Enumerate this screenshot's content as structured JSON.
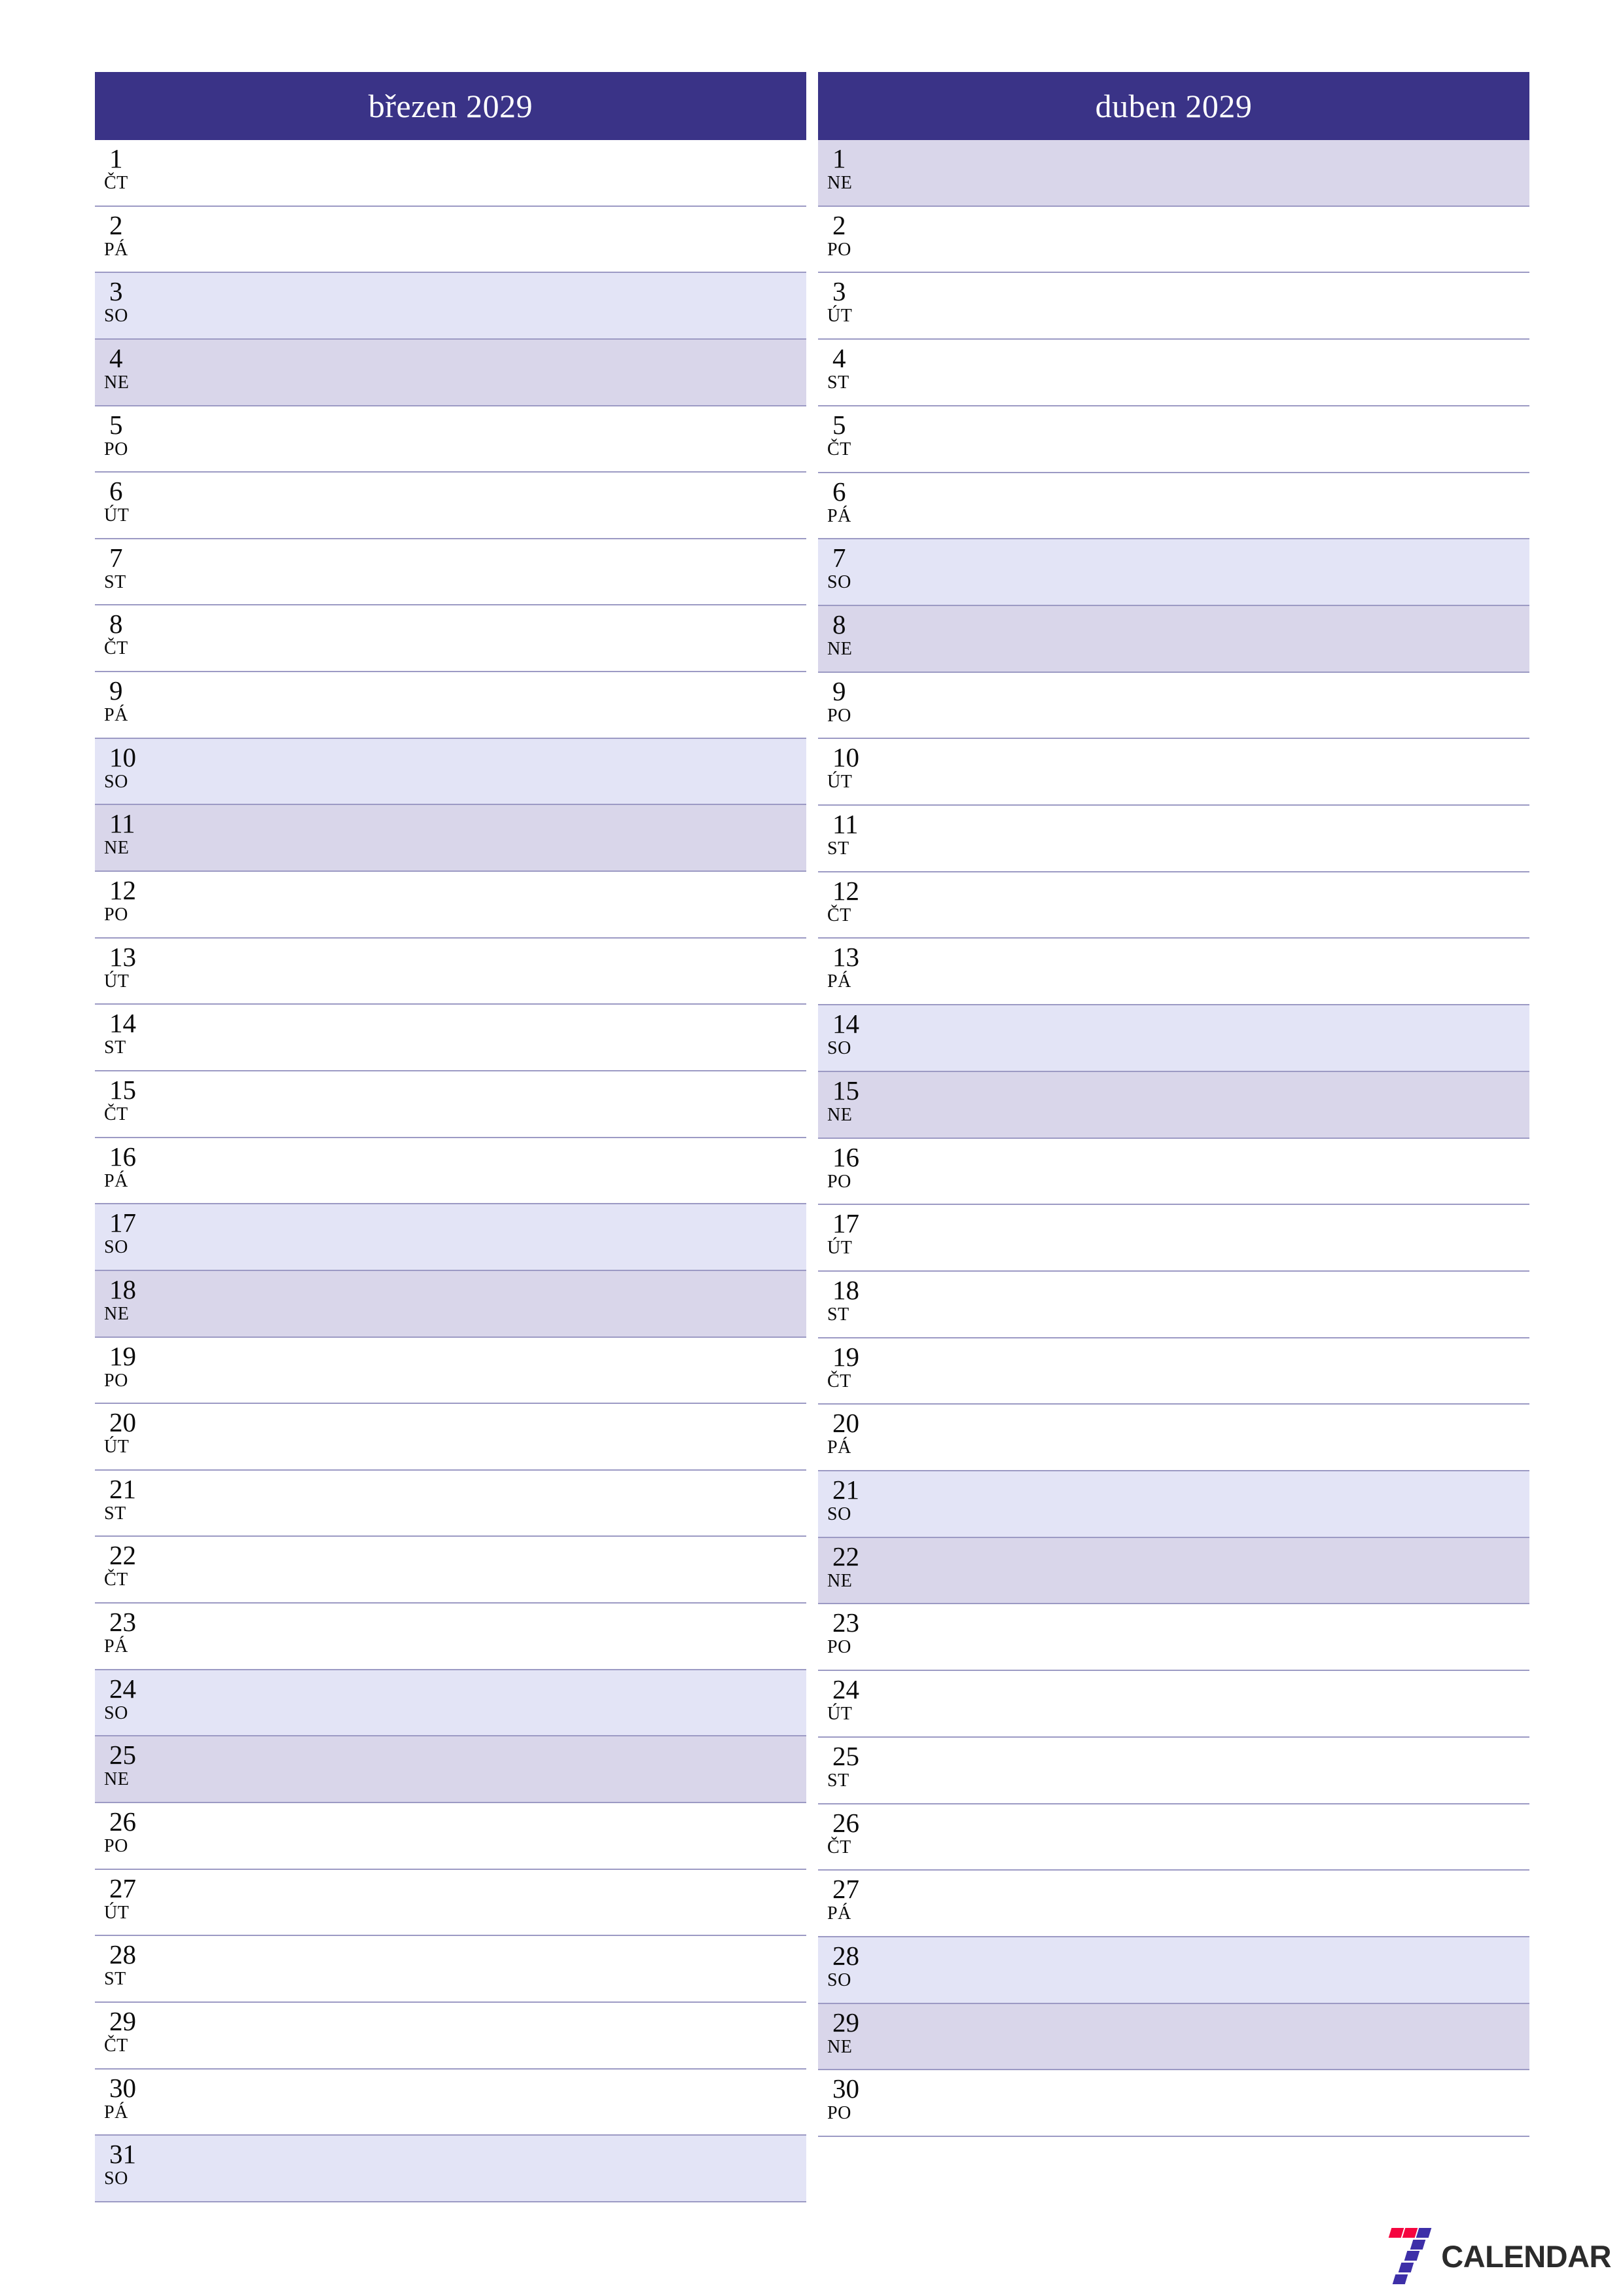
{
  "colors": {
    "header_bg": "#3a3387",
    "header_text": "#ffffff",
    "saturday_bg": "#e3e4f6",
    "sunday_bg": "#d9d6ea",
    "row_border": "#9c9ac4",
    "logo_red": "#f5053f",
    "logo_purple": "#3d2fa8",
    "logo_text": "#2b2b2b"
  },
  "logo": {
    "mark_name": "seven-logo-mark",
    "word": "CALENDAR"
  },
  "months": [
    {
      "title": "březen 2029",
      "days": [
        {
          "num": "1",
          "abbr": "ČT",
          "kind": "weekday"
        },
        {
          "num": "2",
          "abbr": "PÁ",
          "kind": "weekday"
        },
        {
          "num": "3",
          "abbr": "SO",
          "kind": "sat"
        },
        {
          "num": "4",
          "abbr": "NE",
          "kind": "sun"
        },
        {
          "num": "5",
          "abbr": "PO",
          "kind": "weekday"
        },
        {
          "num": "6",
          "abbr": "ÚT",
          "kind": "weekday"
        },
        {
          "num": "7",
          "abbr": "ST",
          "kind": "weekday"
        },
        {
          "num": "8",
          "abbr": "ČT",
          "kind": "weekday"
        },
        {
          "num": "9",
          "abbr": "PÁ",
          "kind": "weekday"
        },
        {
          "num": "10",
          "abbr": "SO",
          "kind": "sat"
        },
        {
          "num": "11",
          "abbr": "NE",
          "kind": "sun"
        },
        {
          "num": "12",
          "abbr": "PO",
          "kind": "weekday"
        },
        {
          "num": "13",
          "abbr": "ÚT",
          "kind": "weekday"
        },
        {
          "num": "14",
          "abbr": "ST",
          "kind": "weekday"
        },
        {
          "num": "15",
          "abbr": "ČT",
          "kind": "weekday"
        },
        {
          "num": "16",
          "abbr": "PÁ",
          "kind": "weekday"
        },
        {
          "num": "17",
          "abbr": "SO",
          "kind": "sat"
        },
        {
          "num": "18",
          "abbr": "NE",
          "kind": "sun"
        },
        {
          "num": "19",
          "abbr": "PO",
          "kind": "weekday"
        },
        {
          "num": "20",
          "abbr": "ÚT",
          "kind": "weekday"
        },
        {
          "num": "21",
          "abbr": "ST",
          "kind": "weekday"
        },
        {
          "num": "22",
          "abbr": "ČT",
          "kind": "weekday"
        },
        {
          "num": "23",
          "abbr": "PÁ",
          "kind": "weekday"
        },
        {
          "num": "24",
          "abbr": "SO",
          "kind": "sat"
        },
        {
          "num": "25",
          "abbr": "NE",
          "kind": "sun"
        },
        {
          "num": "26",
          "abbr": "PO",
          "kind": "weekday"
        },
        {
          "num": "27",
          "abbr": "ÚT",
          "kind": "weekday"
        },
        {
          "num": "28",
          "abbr": "ST",
          "kind": "weekday"
        },
        {
          "num": "29",
          "abbr": "ČT",
          "kind": "weekday"
        },
        {
          "num": "30",
          "abbr": "PÁ",
          "kind": "weekday"
        },
        {
          "num": "31",
          "abbr": "SO",
          "kind": "sat"
        }
      ]
    },
    {
      "title": "duben 2029",
      "days": [
        {
          "num": "1",
          "abbr": "NE",
          "kind": "sun"
        },
        {
          "num": "2",
          "abbr": "PO",
          "kind": "weekday"
        },
        {
          "num": "3",
          "abbr": "ÚT",
          "kind": "weekday"
        },
        {
          "num": "4",
          "abbr": "ST",
          "kind": "weekday"
        },
        {
          "num": "5",
          "abbr": "ČT",
          "kind": "weekday"
        },
        {
          "num": "6",
          "abbr": "PÁ",
          "kind": "weekday"
        },
        {
          "num": "7",
          "abbr": "SO",
          "kind": "sat"
        },
        {
          "num": "8",
          "abbr": "NE",
          "kind": "sun"
        },
        {
          "num": "9",
          "abbr": "PO",
          "kind": "weekday"
        },
        {
          "num": "10",
          "abbr": "ÚT",
          "kind": "weekday"
        },
        {
          "num": "11",
          "abbr": "ST",
          "kind": "weekday"
        },
        {
          "num": "12",
          "abbr": "ČT",
          "kind": "weekday"
        },
        {
          "num": "13",
          "abbr": "PÁ",
          "kind": "weekday"
        },
        {
          "num": "14",
          "abbr": "SO",
          "kind": "sat"
        },
        {
          "num": "15",
          "abbr": "NE",
          "kind": "sun"
        },
        {
          "num": "16",
          "abbr": "PO",
          "kind": "weekday"
        },
        {
          "num": "17",
          "abbr": "ÚT",
          "kind": "weekday"
        },
        {
          "num": "18",
          "abbr": "ST",
          "kind": "weekday"
        },
        {
          "num": "19",
          "abbr": "ČT",
          "kind": "weekday"
        },
        {
          "num": "20",
          "abbr": "PÁ",
          "kind": "weekday"
        },
        {
          "num": "21",
          "abbr": "SO",
          "kind": "sat"
        },
        {
          "num": "22",
          "abbr": "NE",
          "kind": "sun"
        },
        {
          "num": "23",
          "abbr": "PO",
          "kind": "weekday"
        },
        {
          "num": "24",
          "abbr": "ÚT",
          "kind": "weekday"
        },
        {
          "num": "25",
          "abbr": "ST",
          "kind": "weekday"
        },
        {
          "num": "26",
          "abbr": "ČT",
          "kind": "weekday"
        },
        {
          "num": "27",
          "abbr": "PÁ",
          "kind": "weekday"
        },
        {
          "num": "28",
          "abbr": "SO",
          "kind": "sat"
        },
        {
          "num": "29",
          "abbr": "NE",
          "kind": "sun"
        },
        {
          "num": "30",
          "abbr": "PO",
          "kind": "weekday"
        },
        {
          "num": "",
          "abbr": "",
          "kind": "blank"
        }
      ]
    }
  ]
}
